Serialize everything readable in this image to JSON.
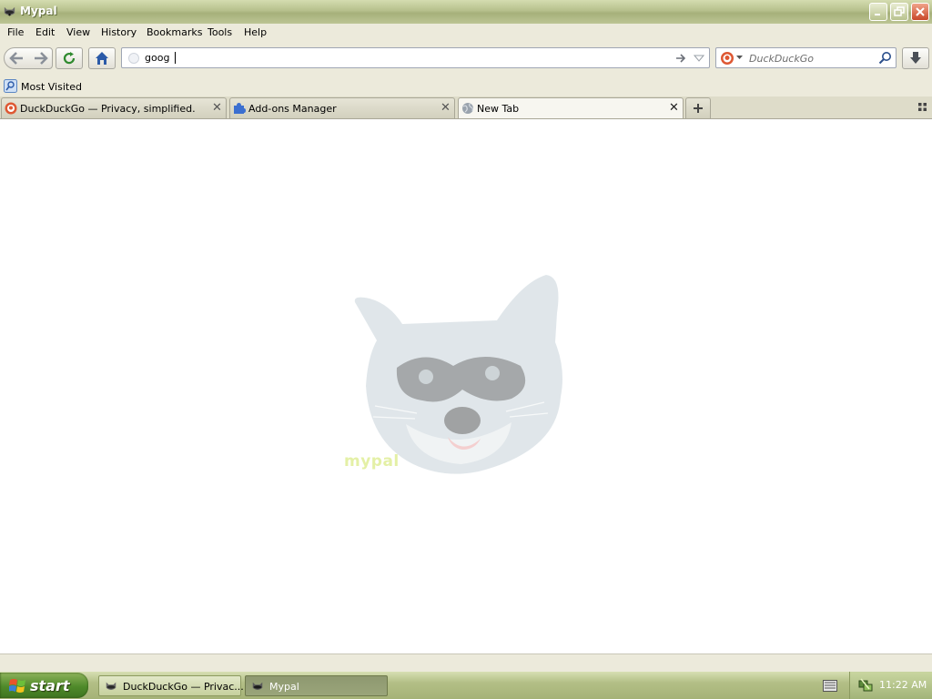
{
  "window": {
    "title": "Mypal"
  },
  "menu": [
    {
      "label": "File"
    },
    {
      "label": "Edit"
    },
    {
      "label": "View"
    },
    {
      "label": "History"
    },
    {
      "label": "Bookmarks"
    },
    {
      "label": "Tools"
    },
    {
      "label": "Help"
    }
  ],
  "urlbar": {
    "value": "goog"
  },
  "searchbar": {
    "engine": "DuckDuckGo",
    "placeholder": "DuckDuckGo"
  },
  "bookmarks": {
    "most_visited": "Most Visited"
  },
  "tabs": [
    {
      "label": "DuckDuckGo — Privacy, simplified.",
      "icon": "duckduckgo-icon"
    },
    {
      "label": "Add-ons Manager",
      "icon": "puzzle-piece-icon"
    },
    {
      "label": "New Tab",
      "icon": "globe-icon",
      "selected": true
    }
  ],
  "newtab": {
    "logo_text": "mypal"
  },
  "taskbar": {
    "start": "start",
    "items": [
      {
        "label": "DuckDuckGo — Privac..."
      },
      {
        "label": "Mypal",
        "active": true
      }
    ],
    "clock": "11:22 AM"
  },
  "colors": {
    "titlebar": "#b6c08c",
    "chrome": "#eceadb",
    "start_green": "#4f8a2a"
  }
}
